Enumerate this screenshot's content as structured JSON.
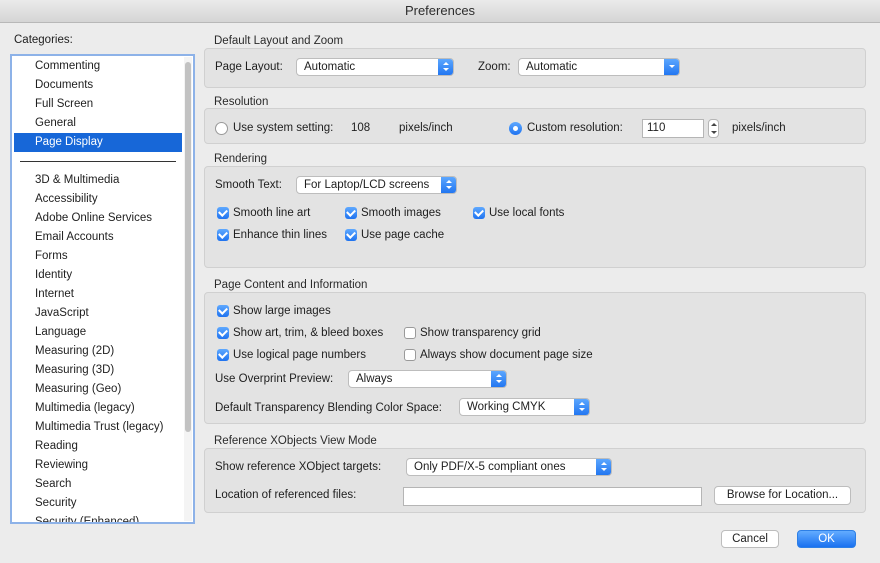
{
  "window": {
    "title": "Preferences"
  },
  "categories": {
    "heading": "Categories:",
    "top_items": [
      "Commenting",
      "Documents",
      "Full Screen",
      "General",
      "Page Display"
    ],
    "selected": "Page Display",
    "items": [
      "3D & Multimedia",
      "Accessibility",
      "Adobe Online Services",
      "Email Accounts",
      "Forms",
      "Identity",
      "Internet",
      "JavaScript",
      "Language",
      "Measuring (2D)",
      "Measuring (3D)",
      "Measuring (Geo)",
      "Multimedia (legacy)",
      "Multimedia Trust (legacy)",
      "Reading",
      "Reviewing",
      "Search",
      "Security",
      "Security (Enhanced)"
    ]
  },
  "layout_zoom": {
    "title": "Default Layout and Zoom",
    "page_layout_label": "Page Layout:",
    "page_layout_value": "Automatic",
    "zoom_label": "Zoom:",
    "zoom_value": "Automatic"
  },
  "resolution": {
    "title": "Resolution",
    "use_system_label": "Use system setting:",
    "use_system_checked": false,
    "system_value": "108",
    "system_unit": "pixels/inch",
    "custom_label": "Custom resolution:",
    "custom_checked": true,
    "custom_value": "110",
    "custom_unit": "pixels/inch"
  },
  "rendering": {
    "title": "Rendering",
    "smooth_text_label": "Smooth Text:",
    "smooth_text_value": "For Laptop/LCD screens",
    "checkboxes": [
      {
        "label": "Smooth line art",
        "checked": true
      },
      {
        "label": "Smooth images",
        "checked": true
      },
      {
        "label": "Use local fonts",
        "checked": true
      },
      {
        "label": "Enhance thin lines",
        "checked": true
      },
      {
        "label": "Use page cache",
        "checked": true
      }
    ]
  },
  "page_content": {
    "title": "Page Content and Information",
    "checkboxes": [
      {
        "label": "Show large images",
        "checked": true
      },
      {
        "label": "Show art, trim, & bleed boxes",
        "checked": true
      },
      {
        "label": "Show transparency grid",
        "checked": false
      },
      {
        "label": "Use logical page numbers",
        "checked": true
      },
      {
        "label": "Always show document page size",
        "checked": false
      }
    ],
    "overprint_label": "Use Overprint Preview:",
    "overprint_value": "Always",
    "blend_label": "Default Transparency Blending Color Space:",
    "blend_value": "Working CMYK"
  },
  "xobjects": {
    "title": "Reference XObjects View Mode",
    "targets_label": "Show reference XObject targets:",
    "targets_value": "Only PDF/X-5 compliant ones",
    "location_label": "Location of referenced files:",
    "location_value": "",
    "browse_label": "Browse for Location..."
  },
  "buttons": {
    "cancel": "Cancel",
    "ok": "OK"
  },
  "colors": {
    "accent": "#1f73f0",
    "selection": "#1767d8"
  }
}
